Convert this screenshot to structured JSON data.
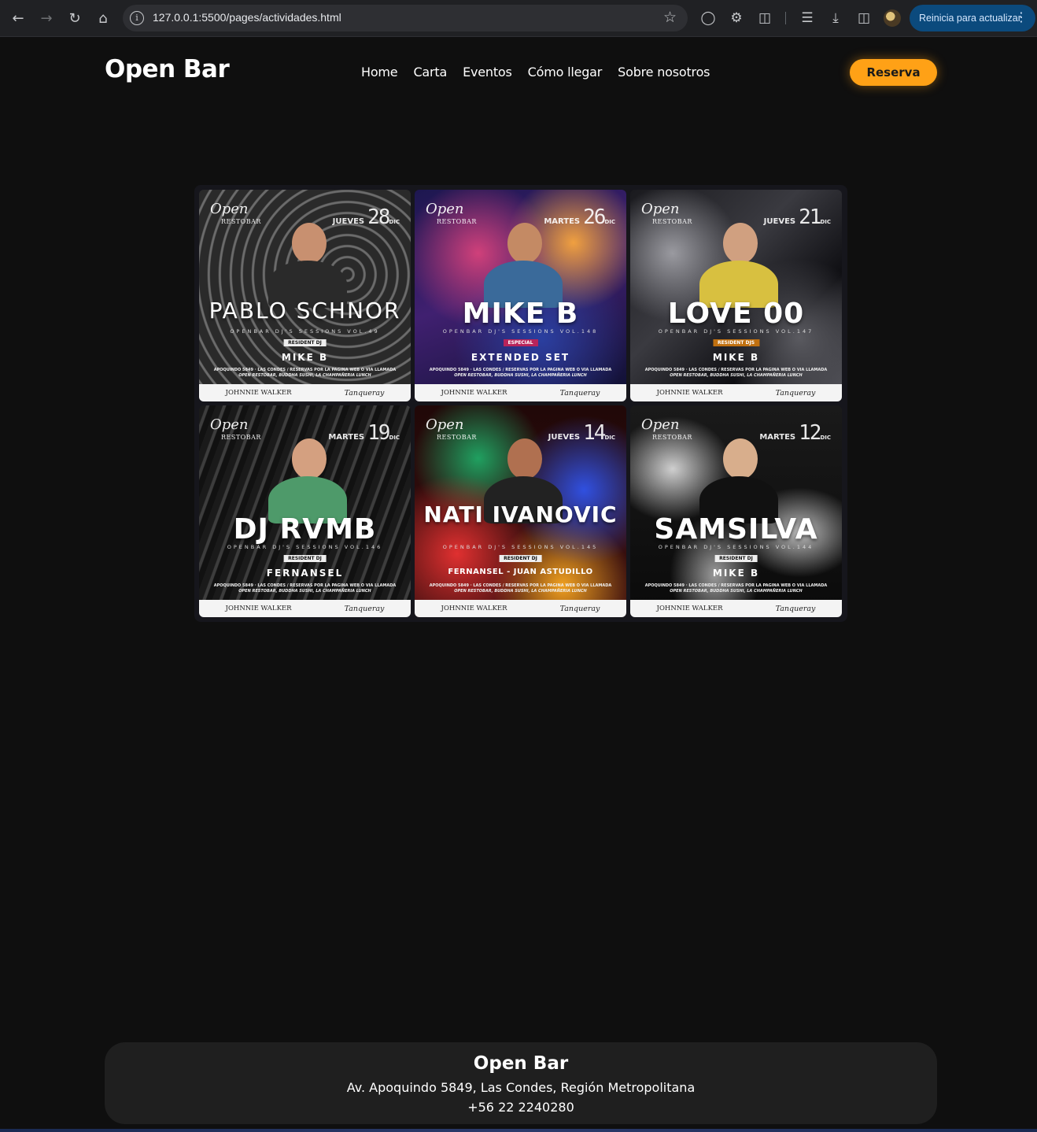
{
  "browser": {
    "url": "127.0.0.1:5500/pages/actividades.html",
    "update_label": "Reinicia para actualizar"
  },
  "header": {
    "brand": "Open Bar",
    "nav": [
      "Home",
      "Carta",
      "Eventos",
      "Cómo llegar",
      "Sobre nosotros"
    ],
    "cta": "Reserva"
  },
  "events": [
    {
      "logo": "Open",
      "logo_sub": "RESTOBAR",
      "day": "JUEVES",
      "date": "28",
      "month": "DIC",
      "headliner": "PABLO SCHNOR",
      "sessions": "OPENBAR DJ'S SESSIONS VOL.49",
      "tag": "RESIDENT DJ",
      "act": "MIKE B",
      "address": "APOQUINDO 5849 · LAS CONDES / RESERVAS POR LA PAGINA WEB O VIA LLAMADA",
      "venues": "OPEN RESTOBAR, BUDDHA SUSHI, LA CHAMPAÑERIA LUNCH",
      "sponsor1": "JOHNNIE WALKER",
      "sponsor2": "Tanqueray",
      "theme": "zebra"
    },
    {
      "logo": "Open",
      "logo_sub": "RESTOBAR",
      "day": "MARTES",
      "date": "26",
      "month": "DIC",
      "headliner": "MIKE B",
      "sessions": "OPENBAR DJ'S SESSIONS VOL.148",
      "tag": "ESPECIAL",
      "act": "EXTENDED SET",
      "address": "APOQUINDO 5849 · LAS CONDES / RESERVAS POR LA PAGINA WEB O VIA LLAMADA",
      "venues": "OPEN RESTOBAR, BUDDHA SUSHI, LA CHAMPAÑERIA LUNCH",
      "sponsor1": "JOHNNIE WALKER",
      "sponsor2": "Tanqueray",
      "theme": "galaxy"
    },
    {
      "logo": "Open",
      "logo_sub": "RESTOBAR",
      "day": "JUEVES",
      "date": "21",
      "month": "DIC",
      "headliner": "LOVE 00",
      "sessions": "OPENBAR DJ'S SESSIONS VOL.147",
      "tag": "RESIDENT DJS",
      "act": "MIKE B",
      "address": "APOQUINDO 5849 · LAS CONDES / RESERVAS POR LA PAGINA WEB O VIA LLAMADA",
      "venues": "OPEN RESTOBAR, BUDDHA SUSHI, LA CHAMPAÑERIA LUNCH",
      "sponsor1": "JOHNNIE WALKER",
      "sponsor2": "Tanqueray",
      "theme": "chrome"
    },
    {
      "logo": "Open",
      "logo_sub": "RESTOBAR",
      "day": "MARTES",
      "date": "19",
      "month": "DIC",
      "headliner": "DJ RVMB",
      "sessions": "OPENBAR DJ'S SESSIONS VOL.146",
      "tag": "RESIDENT DJ",
      "act": "FERNANSEL",
      "address": "APOQUINDO 5849 · LAS CONDES / RESERVAS POR LA PAGINA WEB O VIA LLAMADA",
      "venues": "OPEN RESTOBAR, BUDDHA SUSHI, LA CHAMPAÑERIA LUNCH",
      "sponsor1": "JOHNNIE WALKER",
      "sponsor2": "Tanqueray",
      "theme": "stripes"
    },
    {
      "logo": "Open",
      "logo_sub": "RESTOBAR",
      "day": "JUEVES",
      "date": "14",
      "month": "DIC",
      "headliner": "NATI IVANOVIC",
      "sessions": "OPENBAR DJ'S SESSIONS VOL.145",
      "tag": "RESIDENT DJ",
      "act": "FERNANSEL - JUAN ASTUDILLO",
      "address": "APOQUINDO 5849 · LAS CONDES / RESERVAS POR LA PAGINA WEB O VIA LLAMADA",
      "venues": "OPEN RESTOBAR, BUDDHA SUSHI, LA CHAMPAÑERIA LUNCH",
      "sponsor1": "JOHNNIE WALKER",
      "sponsor2": "Tanqueray",
      "theme": "psychedelic"
    },
    {
      "logo": "Open",
      "logo_sub": "RESTOBAR",
      "day": "MARTES",
      "date": "12",
      "month": "DIC",
      "headliner": "SAMSILVA",
      "sessions": "OPENBAR DJ'S SESSIONS VOL.144",
      "tag": "RESIDENT DJ",
      "act": "MIKE B",
      "address": "APOQUINDO 5849 · LAS CONDES / RESERVAS POR LA PAGINA WEB O VIA LLAMADA",
      "venues": "OPEN RESTOBAR, BUDDHA SUSHI, LA CHAMPAÑERIA LUNCH",
      "sponsor1": "JOHNNIE WALKER",
      "sponsor2": "Tanqueray",
      "theme": "smoke"
    }
  ],
  "footer": {
    "brand": "Open Bar",
    "address": "Av. Apoquindo 5849, Las Condes, Región Metropolitana",
    "phone": "+56 22 2240280"
  },
  "colors": {
    "accent": "#ffa116",
    "background": "#0f0f0f",
    "footer_bg": "#1f1f1f"
  }
}
